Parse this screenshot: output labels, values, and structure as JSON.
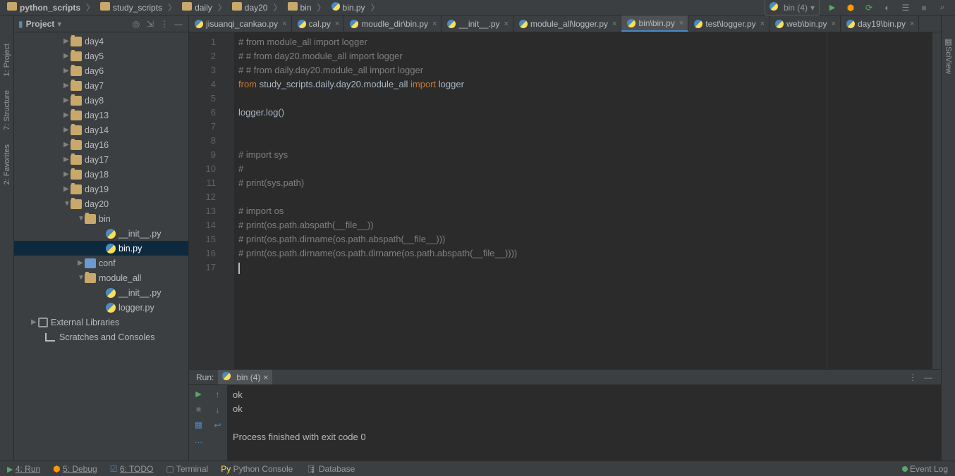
{
  "breadcrumb": [
    "python_scripts",
    "study_scripts",
    "daily",
    "day20",
    "bin",
    "bin.py"
  ],
  "runconf": {
    "label": "bin (4)"
  },
  "proj": {
    "title": "Project"
  },
  "tree": {
    "items": [
      {
        "pad": 70,
        "arrow": "▶",
        "icon": "dir",
        "label": "day4"
      },
      {
        "pad": 70,
        "arrow": "▶",
        "icon": "dir",
        "label": "day5"
      },
      {
        "pad": 70,
        "arrow": "▶",
        "icon": "dir",
        "label": "day6"
      },
      {
        "pad": 70,
        "arrow": "▶",
        "icon": "dir",
        "label": "day7"
      },
      {
        "pad": 70,
        "arrow": "▶",
        "icon": "dir",
        "label": "day8"
      },
      {
        "pad": 70,
        "arrow": "▶",
        "icon": "dir",
        "label": "day13"
      },
      {
        "pad": 70,
        "arrow": "▶",
        "icon": "dir",
        "label": "day14"
      },
      {
        "pad": 70,
        "arrow": "▶",
        "icon": "dir",
        "label": "day16"
      },
      {
        "pad": 70,
        "arrow": "▶",
        "icon": "dir",
        "label": "day17"
      },
      {
        "pad": 70,
        "arrow": "▶",
        "icon": "dir",
        "label": "day18"
      },
      {
        "pad": 70,
        "arrow": "▶",
        "icon": "dir",
        "label": "day19"
      },
      {
        "pad": 70,
        "arrow": "▼",
        "icon": "dir",
        "label": "day20"
      },
      {
        "pad": 90,
        "arrow": "▼",
        "icon": "dir",
        "label": "bin"
      },
      {
        "pad": 120,
        "arrow": "",
        "icon": "py",
        "label": "__init__.py"
      },
      {
        "pad": 120,
        "arrow": "",
        "icon": "py",
        "label": "bin.py",
        "sel": true
      },
      {
        "pad": 90,
        "arrow": "▶",
        "icon": "pkg",
        "label": "conf"
      },
      {
        "pad": 90,
        "arrow": "▼",
        "icon": "dir",
        "label": "module_all"
      },
      {
        "pad": 120,
        "arrow": "",
        "icon": "py",
        "label": "__init__.py"
      },
      {
        "pad": 120,
        "arrow": "",
        "icon": "py",
        "label": "logger.py"
      },
      {
        "pad": 24,
        "arrow": "▶",
        "icon": "lib",
        "label": "External Libraries"
      },
      {
        "pad": 34,
        "arrow": "",
        "icon": "scr",
        "label": "Scratches and Consoles"
      }
    ]
  },
  "tabs": [
    {
      "label": "jisuanqi_cankao.py"
    },
    {
      "label": "cal.py"
    },
    {
      "label": "moudle_dir\\bin.py"
    },
    {
      "label": "__init__.py"
    },
    {
      "label": "module_all\\logger.py"
    },
    {
      "label": "bin\\bin.py",
      "active": true
    },
    {
      "label": "test\\logger.py"
    },
    {
      "label": "web\\bin.py"
    },
    {
      "label": "day19\\bin.py"
    }
  ],
  "code": {
    "lines": [
      {
        "n": "1",
        "html": "<span class='c'># from module_all import logger</span>"
      },
      {
        "n": "2",
        "html": "<span class='c'># # from day20.module_all import logger</span>"
      },
      {
        "n": "3",
        "html": "<span class='c'># # from daily.day20.module_all import logger</span>"
      },
      {
        "n": "4",
        "html": "<span class='k'>from</span> <span class='m'>study_scripts.daily.day20.module_all</span> <span class='k'>import</span> <span class='m'>logger</span>"
      },
      {
        "n": "5",
        "html": ""
      },
      {
        "n": "6",
        "html": "logger.log()"
      },
      {
        "n": "7",
        "html": ""
      },
      {
        "n": "8",
        "html": ""
      },
      {
        "n": "9",
        "html": "<span class='c'># import sys</span>"
      },
      {
        "n": "10",
        "html": "<span class='c'>#</span>"
      },
      {
        "n": "11",
        "html": "<span class='c'># print(sys.path)</span>"
      },
      {
        "n": "12",
        "html": ""
      },
      {
        "n": "13",
        "html": "<span class='c'># import os</span>"
      },
      {
        "n": "14",
        "html": "<span class='c'># print(os.path.abspath(__file__))</span>"
      },
      {
        "n": "15",
        "html": "<span class='c'># print(os.path.dirname(os.path.abspath(__file__)))</span>"
      },
      {
        "n": "16",
        "html": "<span class='c'># print(os.path.dirname(os.path.dirname(os.path.abspath(__file__))))</span>"
      },
      {
        "n": "17",
        "html": "<span class='crt'></span>"
      }
    ]
  },
  "run": {
    "title": "Run:",
    "tab": "bin (4)",
    "output": [
      "ok",
      "ok",
      "",
      "Process finished with exit code 0"
    ]
  },
  "left": {
    "a": "1: Project",
    "b": "7: Structure",
    "c": "2: Favorites"
  },
  "right": {
    "a": "SciView"
  },
  "status": {
    "run": "4: Run",
    "debug": "5: Debug",
    "todo": "6: TODO",
    "term": "Terminal",
    "pycon": "Python Console",
    "db": "Database",
    "log": "Event Log"
  }
}
